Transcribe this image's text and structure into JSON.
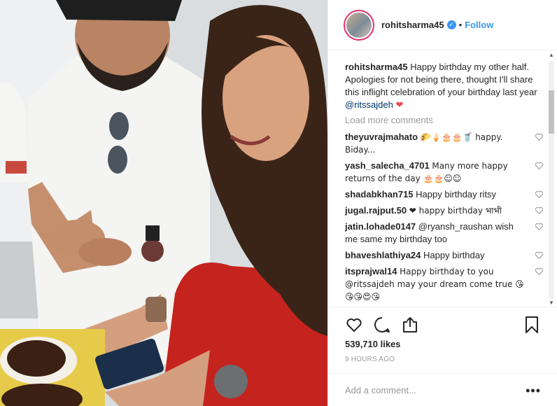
{
  "header": {
    "username": "rohitsharma45",
    "verified_symbol": "✓",
    "separator": "•",
    "follow_label": "Follow"
  },
  "caption": {
    "user": "rohitsharma45",
    "text": "Happy birthday my other half. Apologies for not being there, thought I'll share this inflight celebration of your birthday last year",
    "mention": "@ritssajdeh",
    "emoji": "❤"
  },
  "load_more": "Load more comments",
  "comments": [
    {
      "user": "theyuvrajmahato",
      "text": "🌮🍦🎂🎂🥤 happy. Biday..."
    },
    {
      "user": "yash_salecha_4701",
      "text": "Many more happy returns of the day 🎂🎂☺☺"
    },
    {
      "user": "shadabkhan715",
      "text": "Happy birthday ritsy"
    },
    {
      "user": "jugal.rajput.50",
      "text": "❤ happy birthday भाभी"
    },
    {
      "user": "jatin.lohade0147",
      "text": "@ryansh_raushan wish me same my birthday too"
    },
    {
      "user": "bhaveshlathiya24",
      "text": "Happy birthday"
    },
    {
      "user": "itsprajwal14",
      "text": "Happy birthday to you @ritssajdeh may your dream come true 😘😘😘😍😘"
    }
  ],
  "likes": "539,710 likes",
  "time": "9 HOURS AGO",
  "add_comment_placeholder": "Add a comment...",
  "more_options": "•••",
  "icons": {
    "like": "heart-outline-icon",
    "comment": "speech-bubble-icon",
    "share": "share-icon",
    "save": "bookmark-icon",
    "comment_like": "small-heart-icon"
  },
  "colors": {
    "accent": "#3897f0",
    "text": "#262626",
    "muted": "#999999",
    "mention": "#003569",
    "heart": "#ed4956"
  }
}
